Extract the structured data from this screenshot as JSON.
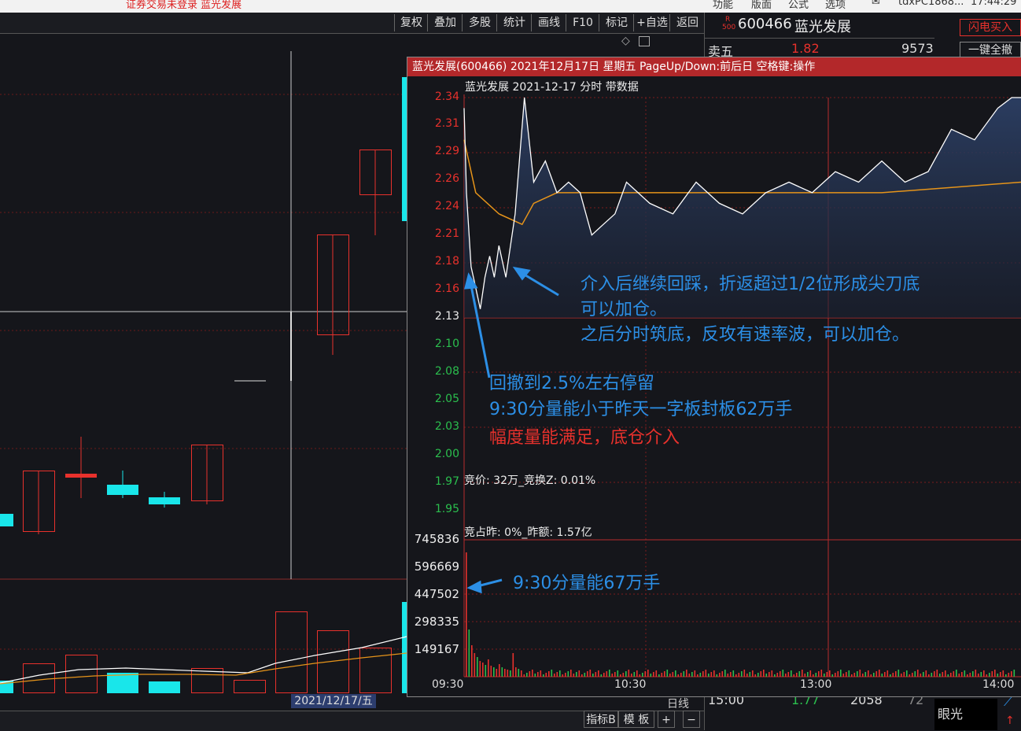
{
  "topbar": {
    "status": "证券交易未登录 蓝光发展",
    "menus": [
      "功能",
      "版面",
      "公式",
      "选项"
    ],
    "user": "tdxPC1868...",
    "clock": "17:44:29"
  },
  "toolbar": {
    "buttons": [
      "复权",
      "叠加",
      "多股",
      "统计",
      "画线",
      "F10",
      "标记",
      "+自选",
      "返回"
    ]
  },
  "right_panel": {
    "badge_top": "R",
    "badge_bottom": "500",
    "code": "600466",
    "name": "蓝光发展",
    "flash_buy": "闪电买入",
    "cancel_all": "一键全撤",
    "sell5_label": "卖五",
    "sell5_price": "1.82",
    "sell5_vol": "9573",
    "tick_time": "15:00",
    "tick_price": "1.77",
    "tick_vol": "2058",
    "tick_extra": "72",
    "eye_label": "眼光"
  },
  "main": {
    "date_label": "2021/12/17/五",
    "period": "日线"
  },
  "bottom": {
    "buttons": [
      "指标B",
      "模 板",
      "+",
      "−"
    ]
  },
  "popup": {
    "title": "蓝光发展(600466) 2021年12月17日 星期五 PageUp/Down:前后日 空格键:操作",
    "subtitle": "蓝光发展  2021-12-17 分时 带数据",
    "auction_price": "竞价: 32万_竞换Z: 0.01%",
    "auction_ratio": "竞占昨: 0%_昨额: 1.57亿"
  },
  "annotations": {
    "a1": "介入后继续回踩，折返超过1/2位形成尖刀底",
    "a2": "可以加仓。",
    "a3": "之后分时筑底，反攻有速率波，可以加仓。",
    "b1": "回撤到2.5%左右停留",
    "b2": "9:30分量能小于昨天一字板封板62万手",
    "c1": "幅度量能满足，底仓介入",
    "d1": "9:30分量能67万手"
  },
  "chart_data": {
    "type": "line",
    "title": "蓝光发展  2021-12-17 分时 带数据",
    "x_ticks": [
      "09:30",
      "10:30",
      "13:00",
      "14:00"
    ],
    "price_ticks": [
      "2.34",
      "2.31",
      "2.29",
      "2.26",
      "2.24",
      "2.21",
      "2.18",
      "2.16",
      "2.13",
      "2.10",
      "2.08",
      "2.05",
      "2.03",
      "2.00",
      "1.97",
      "1.95"
    ],
    "prev_close": 2.13,
    "volume_ticks": [
      "745836",
      "596669",
      "447502",
      "298335",
      "149167"
    ],
    "colors": {
      "up": "#e8312c",
      "down": "#2bbf4e",
      "price_line": "#ffffff",
      "avg_line": "#e6941a"
    },
    "series": [
      {
        "x": [
          0,
          1,
          3,
          5,
          7,
          9,
          11,
          13,
          15,
          18,
          22,
          26,
          30,
          35,
          40,
          45,
          50,
          55,
          60,
          65,
          70,
          80,
          90,
          100,
          110,
          120,
          130,
          140,
          150,
          160,
          170,
          180,
          190,
          200,
          210,
          220,
          230,
          236,
          240
        ],
        "values": [
          2.33,
          2.25,
          2.18,
          2.16,
          2.14,
          2.17,
          2.19,
          2.17,
          2.2,
          2.17,
          2.23,
          2.34,
          2.26,
          2.28,
          2.25,
          2.26,
          2.25,
          2.21,
          2.22,
          2.23,
          2.26,
          2.24,
          2.23,
          2.26,
          2.24,
          2.23,
          2.25,
          2.26,
          2.25,
          2.27,
          2.26,
          2.28,
          2.26,
          2.27,
          2.31,
          2.3,
          2.33,
          2.34,
          2.34
        ]
      },
      {
        "x": [
          0,
          5,
          15,
          25,
          30,
          40,
          60,
          90,
          120,
          150,
          180,
          210,
          240
        ],
        "values": [
          2.3,
          2.25,
          2.23,
          2.22,
          2.24,
          2.25,
          2.25,
          2.25,
          2.25,
          2.25,
          2.25,
          2.255,
          2.26
        ]
      }
    ]
  }
}
